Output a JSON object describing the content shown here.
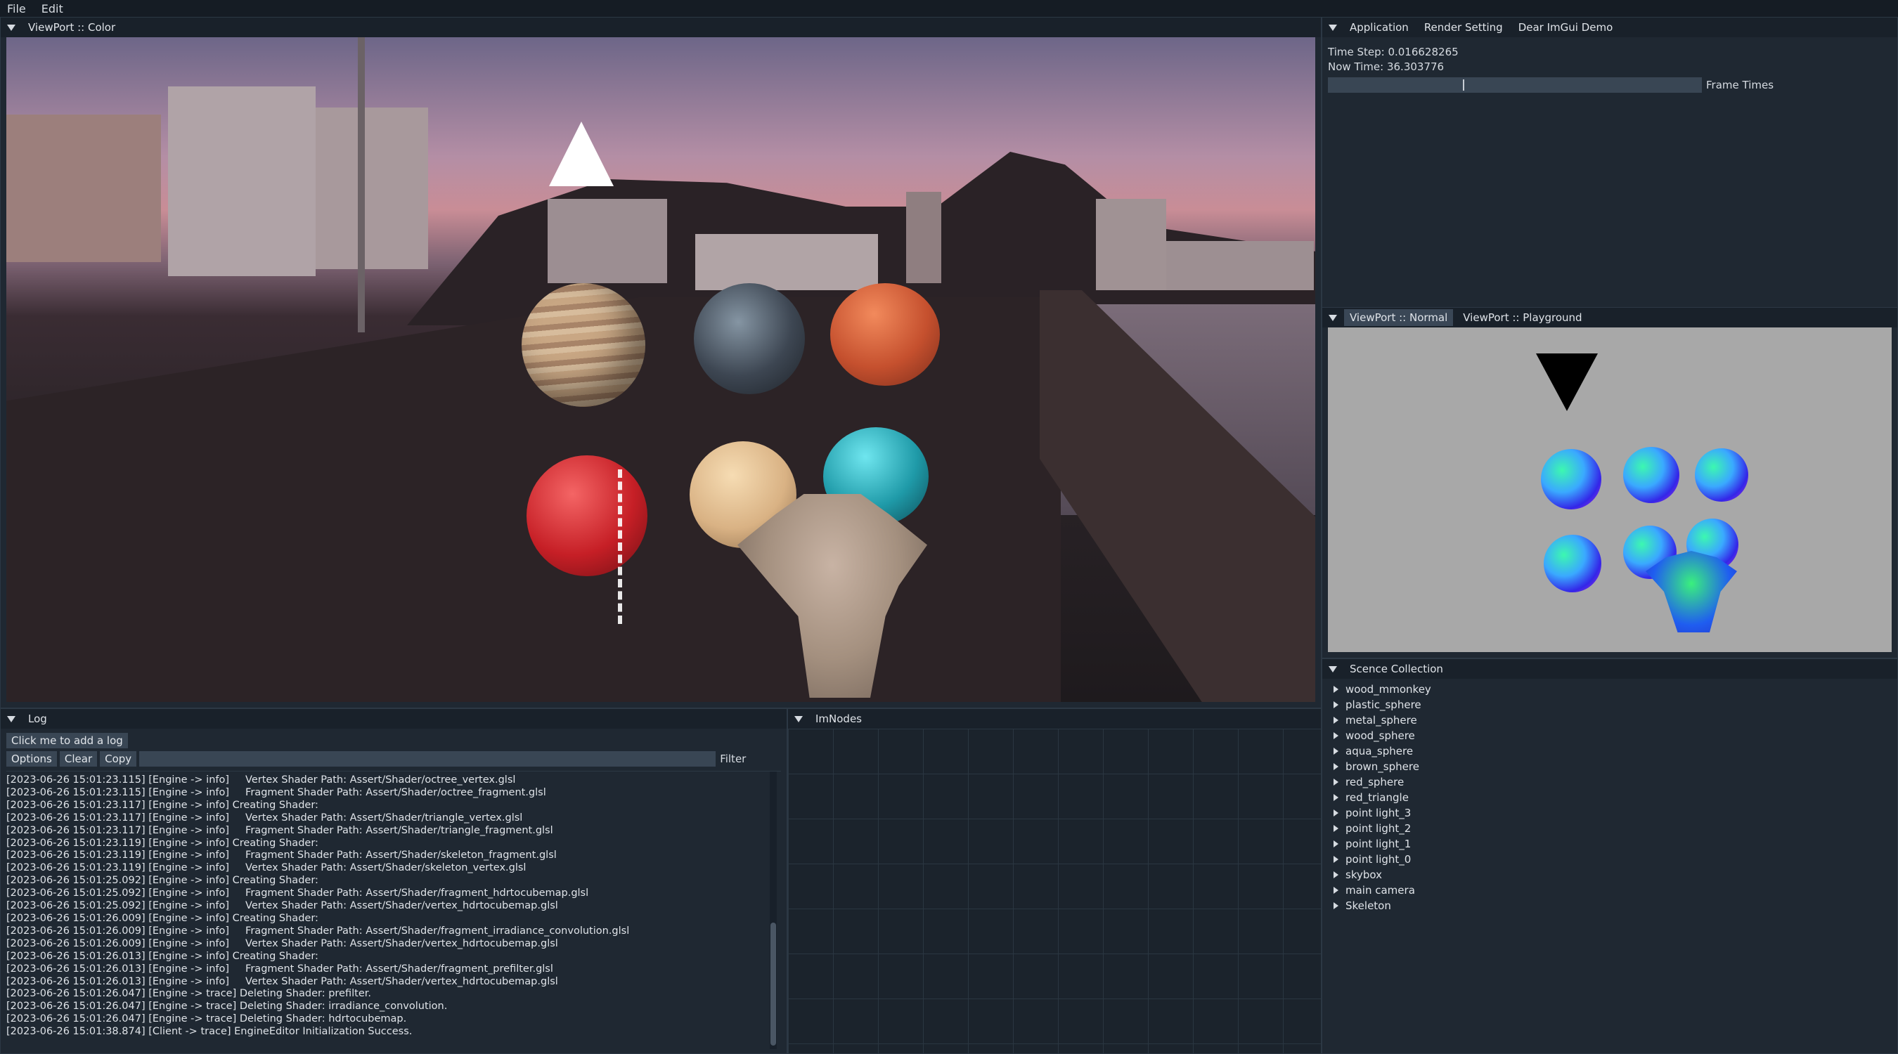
{
  "menubar": {
    "items": [
      "File",
      "Edit"
    ]
  },
  "viewport_color": {
    "tab": "ViewPort :: Color"
  },
  "app_panel": {
    "tabs": [
      "Application",
      "Render Setting",
      "Dear ImGui Demo"
    ],
    "time_step": "Time Step: 0.016628265",
    "now_time": "Now Time: 36.303776",
    "frame_times_label": "Frame Times",
    "frame_progress": 0.36
  },
  "viewport_normal": {
    "tabs": [
      "ViewPort :: Normal",
      "ViewPort :: Playground"
    ]
  },
  "scene_collection": {
    "title": "Scence Collection",
    "items": [
      "wood_mmonkey",
      "plastic_sphere",
      "metal_sphere",
      "wood_sphere",
      "aqua_sphere",
      "brown_sphere",
      "red_sphere",
      "red_triangle",
      "point light_3",
      "point light_2",
      "point light_1",
      "point light_0",
      "skybox",
      "main camera",
      "Skeleton"
    ]
  },
  "log": {
    "title": "Log",
    "add_button": "Click me to add a log",
    "options_button": "Options",
    "clear_button": "Clear",
    "copy_button": "Copy",
    "filter_label": "Filter",
    "filter_value": "",
    "lines": [
      "[2023-06-26 15:01:23.115] [Engine -> info]     Vertex Shader Path: Assert/Shader/octree_vertex.glsl",
      "[2023-06-26 15:01:23.115] [Engine -> info]     Fragment Shader Path: Assert/Shader/octree_fragment.glsl",
      "[2023-06-26 15:01:23.117] [Engine -> info] Creating Shader:",
      "[2023-06-26 15:01:23.117] [Engine -> info]     Vertex Shader Path: Assert/Shader/triangle_vertex.glsl",
      "[2023-06-26 15:01:23.117] [Engine -> info]     Fragment Shader Path: Assert/Shader/triangle_fragment.glsl",
      "[2023-06-26 15:01:23.119] [Engine -> info] Creating Shader:",
      "[2023-06-26 15:01:23.119] [Engine -> info]     Fragment Shader Path: Assert/Shader/skeleton_fragment.glsl",
      "[2023-06-26 15:01:23.119] [Engine -> info]     Vertex Shader Path: Assert/Shader/skeleton_vertex.glsl",
      "[2023-06-26 15:01:25.092] [Engine -> info] Creating Shader:",
      "[2023-06-26 15:01:25.092] [Engine -> info]     Fragment Shader Path: Assert/Shader/fragment_hdrtocubemap.glsl",
      "[2023-06-26 15:01:25.092] [Engine -> info]     Vertex Shader Path: Assert/Shader/vertex_hdrtocubemap.glsl",
      "[2023-06-26 15:01:26.009] [Engine -> info] Creating Shader:",
      "[2023-06-26 15:01:26.009] [Engine -> info]     Fragment Shader Path: Assert/Shader/fragment_irradiance_convolution.glsl",
      "[2023-06-26 15:01:26.009] [Engine -> info]     Vertex Shader Path: Assert/Shader/vertex_hdrtocubemap.glsl",
      "[2023-06-26 15:01:26.013] [Engine -> info] Creating Shader:",
      "[2023-06-26 15:01:26.013] [Engine -> info]     Fragment Shader Path: Assert/Shader/fragment_prefilter.glsl",
      "[2023-06-26 15:01:26.013] [Engine -> info]     Vertex Shader Path: Assert/Shader/vertex_hdrtocubemap.glsl",
      "[2023-06-26 15:01:26.047] [Engine -> trace] Deleting Shader: prefilter.",
      "[2023-06-26 15:01:26.047] [Engine -> trace] Deleting Shader: irradiance_convolution.",
      "[2023-06-26 15:01:26.047] [Engine -> trace] Deleting Shader: hdrtocubemap.",
      "[2023-06-26 15:01:38.874] [Client -> trace] EngineEditor Initialization Success."
    ]
  },
  "imnodes": {
    "title": "ImNodes"
  },
  "colors": {
    "accent": "#3a4756",
    "panel": "#1f2832",
    "normal_bg": "#a8a8a8"
  }
}
